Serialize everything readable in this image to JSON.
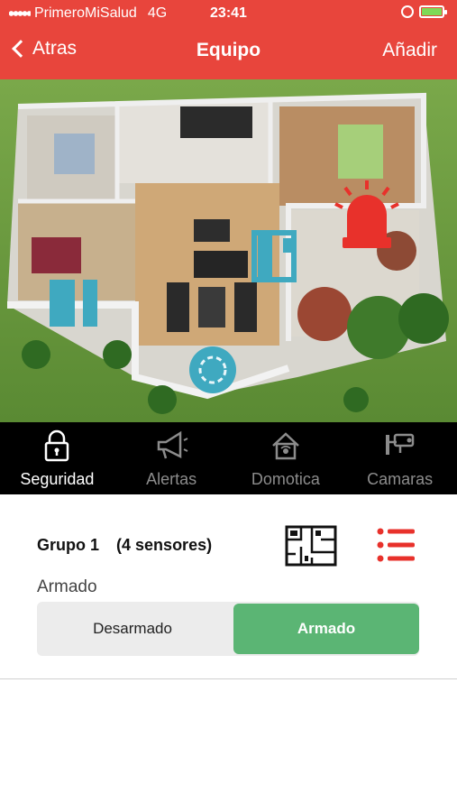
{
  "status_bar": {
    "carrier": "PrimeroMiSalud",
    "network": "4G",
    "time": "23:41",
    "battery_color": "#7ed957"
  },
  "nav": {
    "back_label": "Atras",
    "title": "Equipo",
    "add_label": "Añadir"
  },
  "colors": {
    "header": "#e8453c",
    "accent_green": "#5bb574",
    "sensor_blue": "#3fa9c0"
  },
  "tabs": [
    {
      "label": "Seguridad",
      "icon": "lock-icon",
      "active": true
    },
    {
      "label": "Alertas",
      "icon": "megaphone-icon",
      "active": false
    },
    {
      "label": "Domotica",
      "icon": "smart-home-icon",
      "active": false
    },
    {
      "label": "Camaras",
      "icon": "security-camera-icon",
      "active": false
    }
  ],
  "group": {
    "name": "Grupo 1",
    "sensor_count": "(4 sensores)",
    "state_label": "Armado",
    "options": {
      "disarmed": "Desarmado",
      "armed": "Armado"
    },
    "selected": "armed"
  }
}
